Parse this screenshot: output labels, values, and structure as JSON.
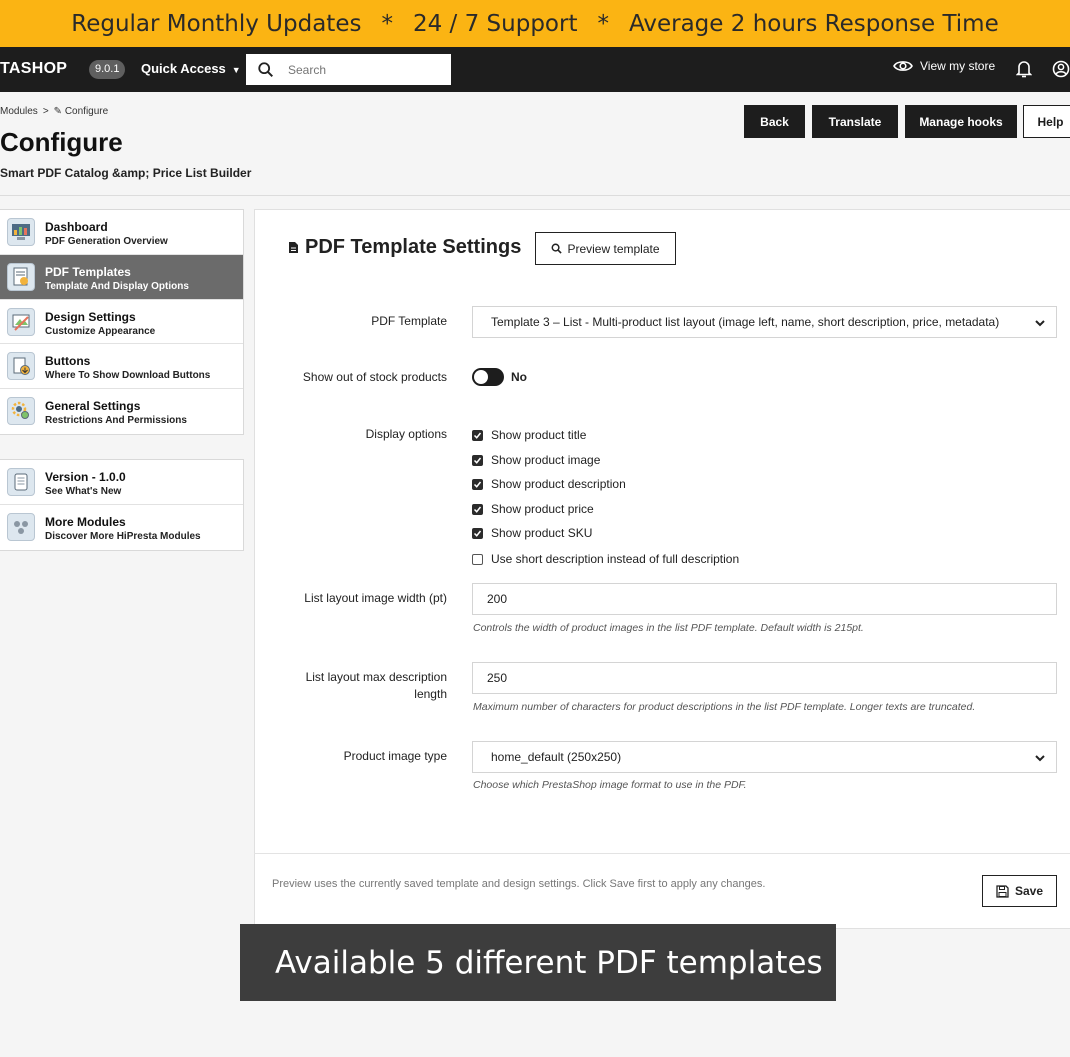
{
  "promo": {
    "item1": "Regular Monthly Updates",
    "sep1": "*",
    "item2": "24 / 7 Support",
    "sep2": "*",
    "item3": "Average 2 hours Response Time",
    "background": "#fbb413"
  },
  "topbar": {
    "brand": "TASHOP",
    "version": "9.0.1",
    "quick_access": "Quick Access",
    "search_placeholder": "Search",
    "view_store": "View my store"
  },
  "breadcrumb": {
    "parent": "Modules",
    "separator": ">",
    "current": "Configure"
  },
  "header": {
    "title": "Configure",
    "subtitle": "Smart PDF Catalog &amp; Price List Builder",
    "buttons": {
      "back": "Back",
      "translate": "Translate",
      "manage_hooks": "Manage hooks",
      "help": "Help"
    }
  },
  "sidebar": {
    "items": [
      {
        "title": "Dashboard",
        "subtitle": "PDF Generation Overview",
        "icon": "dashboard-icon"
      },
      {
        "title": "PDF Templates",
        "subtitle": "Template And Display Options",
        "icon": "pdf-templates-icon",
        "active": true
      },
      {
        "title": "Design Settings",
        "subtitle": "Customize Appearance",
        "icon": "design-icon"
      },
      {
        "title": "Buttons",
        "subtitle": "Where To Show Download Buttons",
        "icon": "buttons-icon"
      },
      {
        "title": "General Settings",
        "subtitle": "Restrictions And Permissions",
        "icon": "settings-icon"
      }
    ],
    "extra": [
      {
        "title": "Version - 1.0.0",
        "subtitle": "See What's New",
        "icon": "version-icon"
      },
      {
        "title": "More Modules",
        "subtitle": "Discover More HiPresta Modules",
        "icon": "modules-icon"
      }
    ]
  },
  "panel": {
    "title": "PDF Template Settings",
    "preview_button": "Preview template",
    "fields": {
      "pdf_template_label": "PDF Template",
      "pdf_template_value": "Template 3 – List - Multi-product list layout (image left, name, short description, price, metadata)",
      "out_of_stock_label": "Show out of stock products",
      "out_of_stock_value": "No",
      "display_options_label": "Display options",
      "display_options": [
        {
          "label": "Show product title",
          "checked": true
        },
        {
          "label": "Show product image",
          "checked": true
        },
        {
          "label": "Show product description",
          "checked": true
        },
        {
          "label": "Show product price",
          "checked": true
        },
        {
          "label": "Show product SKU",
          "checked": true
        },
        {
          "label": "Use short description instead of full description",
          "checked": false
        }
      ],
      "image_width_label": "List layout image width (pt)",
      "image_width_value": "200",
      "image_width_help": "Controls the width of product images in the list PDF template. Default width is 215pt.",
      "max_desc_label_line1": "List layout max description",
      "max_desc_label_line2": "length",
      "max_desc_value": "250",
      "max_desc_help": "Maximum number of characters for product descriptions in the list PDF template. Longer texts are truncated.",
      "image_type_label": "Product image type",
      "image_type_value": "home_default (250x250)",
      "image_type_help": "Choose which PrestaShop image format to use in the PDF."
    },
    "footer_note": "Preview uses the currently saved template and design settings. Click Save first to apply any changes.",
    "save_button": "Save"
  },
  "caption": "Available 5 different PDF templates"
}
